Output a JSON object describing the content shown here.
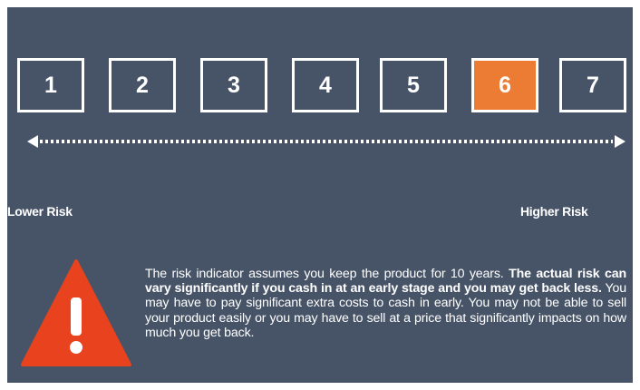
{
  "scale": {
    "levels": [
      "1",
      "2",
      "3",
      "4",
      "5",
      "6",
      "7"
    ],
    "selected_level": 6,
    "active_color": "#ec7c34",
    "background_color": "#475468"
  },
  "labels": {
    "lower": "Lower Risk",
    "higher": "Higher Risk"
  },
  "icons": {
    "arrow": "double-headed-dotted-arrow-icon",
    "warning": "warning-triangle-icon",
    "warning_color": "#e8431e"
  },
  "description": {
    "part1": "The risk indicator assumes you keep the product for 10 years. ",
    "part2_bold": "The actual risk can vary significantly if you cash in at an early stage and you may get back less.",
    "part3": " You may have to pay significant extra costs to cash in early. You may not be able to sell your product easily or you may have to sell at a price that significantly impacts on how much you get back."
  }
}
